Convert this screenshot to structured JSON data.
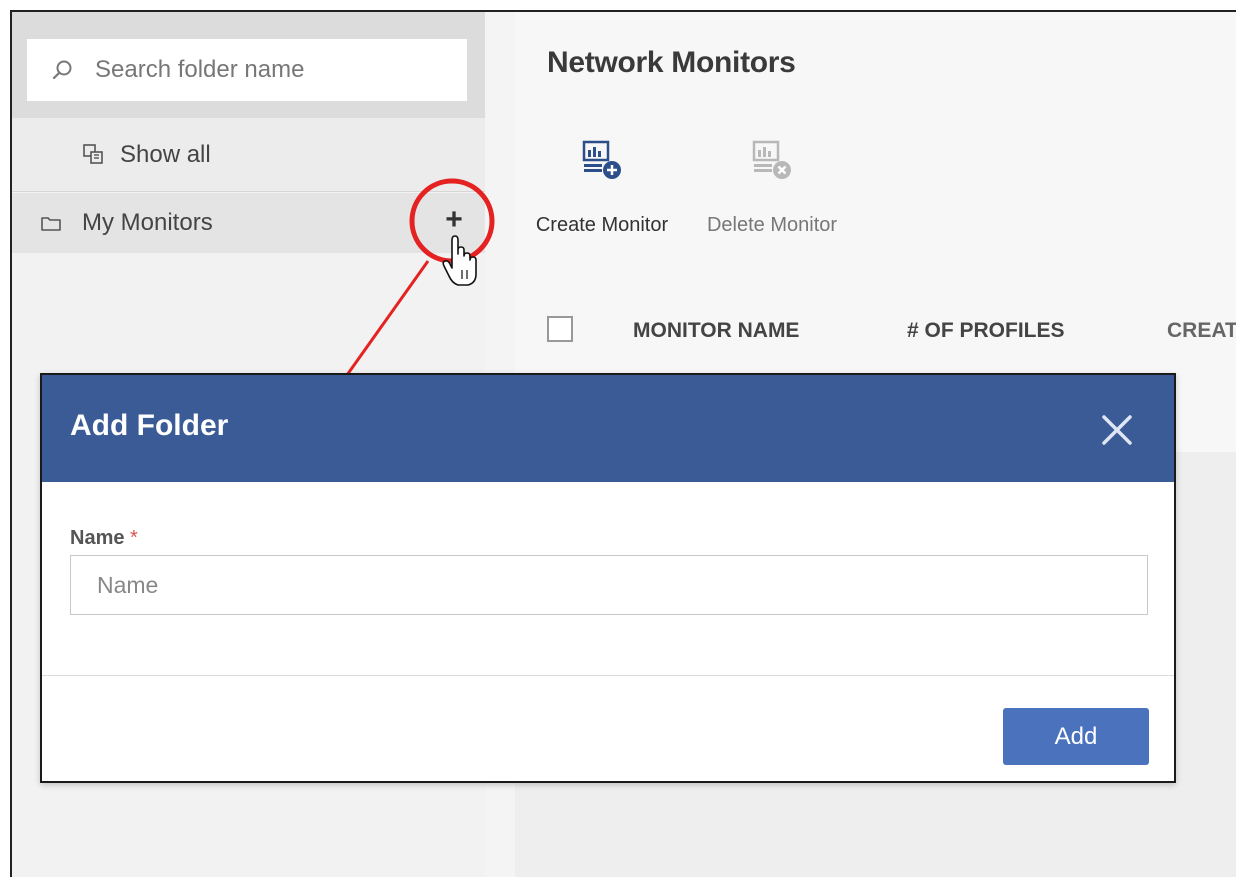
{
  "sidebar": {
    "search": {
      "placeholder": "Search folder name"
    },
    "show_all": "Show all",
    "folders": [
      {
        "label": "My Monitors"
      }
    ],
    "add_folder_symbol": "+"
  },
  "main": {
    "title": "Network Monitors",
    "toolbar": {
      "create_label": "Create Monitor",
      "delete_label": "Delete Monitor"
    },
    "table": {
      "columns": [
        "MONITOR NAME",
        "# OF PROFILES",
        "CREAT"
      ]
    }
  },
  "dialog": {
    "title": "Add Folder",
    "field_label": "Name",
    "required_marker": "*",
    "name_placeholder": "Name",
    "name_value": "",
    "add_label": "Add"
  },
  "colors": {
    "dialog_header": "#3a5b96",
    "primary_button": "#4a72bd",
    "annotation": "#e52222",
    "required": "#d9534f"
  },
  "icons": [
    "search-icon",
    "show-all-icon",
    "folder-icon",
    "plus-icon",
    "create-monitor-icon",
    "delete-monitor-icon",
    "close-icon",
    "hand-cursor-icon"
  ]
}
